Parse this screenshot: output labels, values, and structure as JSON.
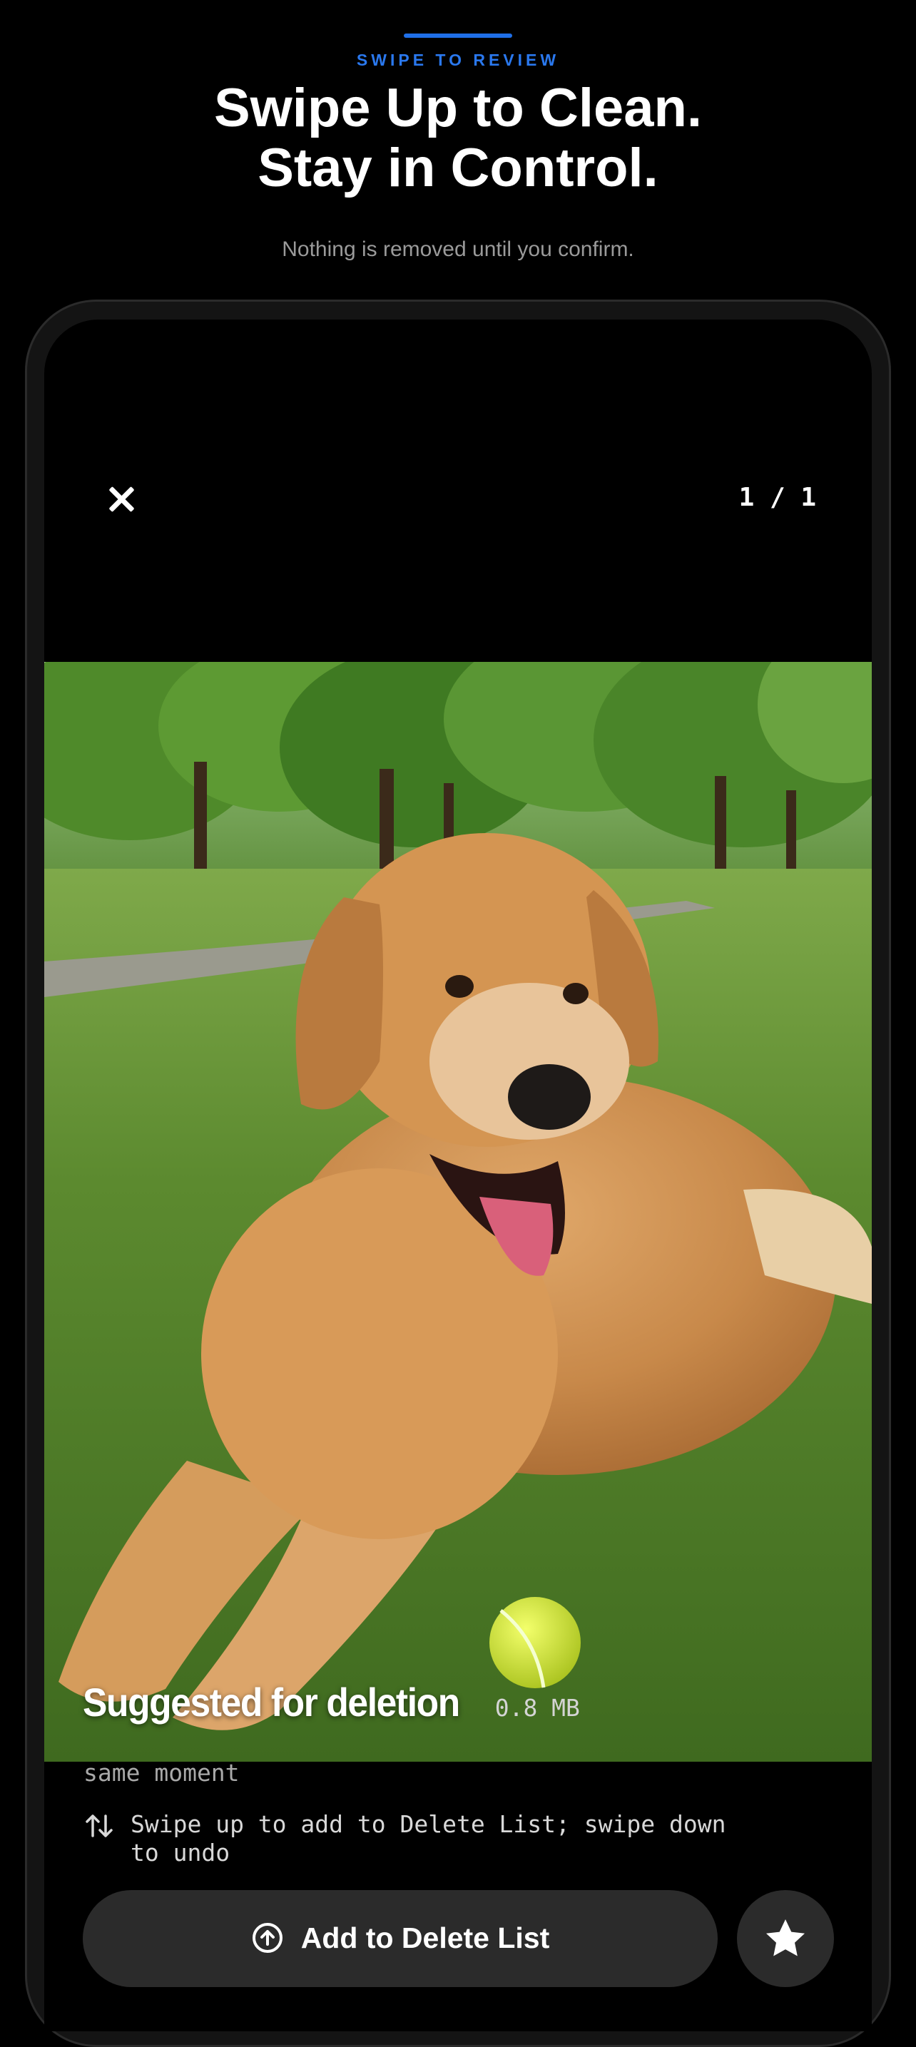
{
  "header": {
    "eyebrow": "SWIPE TO REVIEW",
    "headline_line1": "Swipe Up to Clean.",
    "headline_line2": "Stay in Control.",
    "subtitle": "Nothing is removed until you confirm.",
    "accent_color": "#2a78ee"
  },
  "viewer": {
    "close_icon": "close-icon",
    "counter": "1 / 1",
    "photo_description_icon": "photo-golden-retriever-with-tennis-ball"
  },
  "suggestion": {
    "title": "Suggested for deletion",
    "size": "0.8 MB",
    "reason": "same moment"
  },
  "hint": {
    "icon": "swap-vertical-arrows-icon",
    "text": "Swipe up to add to Delete List; swipe down to undo"
  },
  "actions": {
    "add_label": "Add to Delete List",
    "add_icon": "arrow-up-circle-icon",
    "favorite_icon": "star-icon"
  }
}
